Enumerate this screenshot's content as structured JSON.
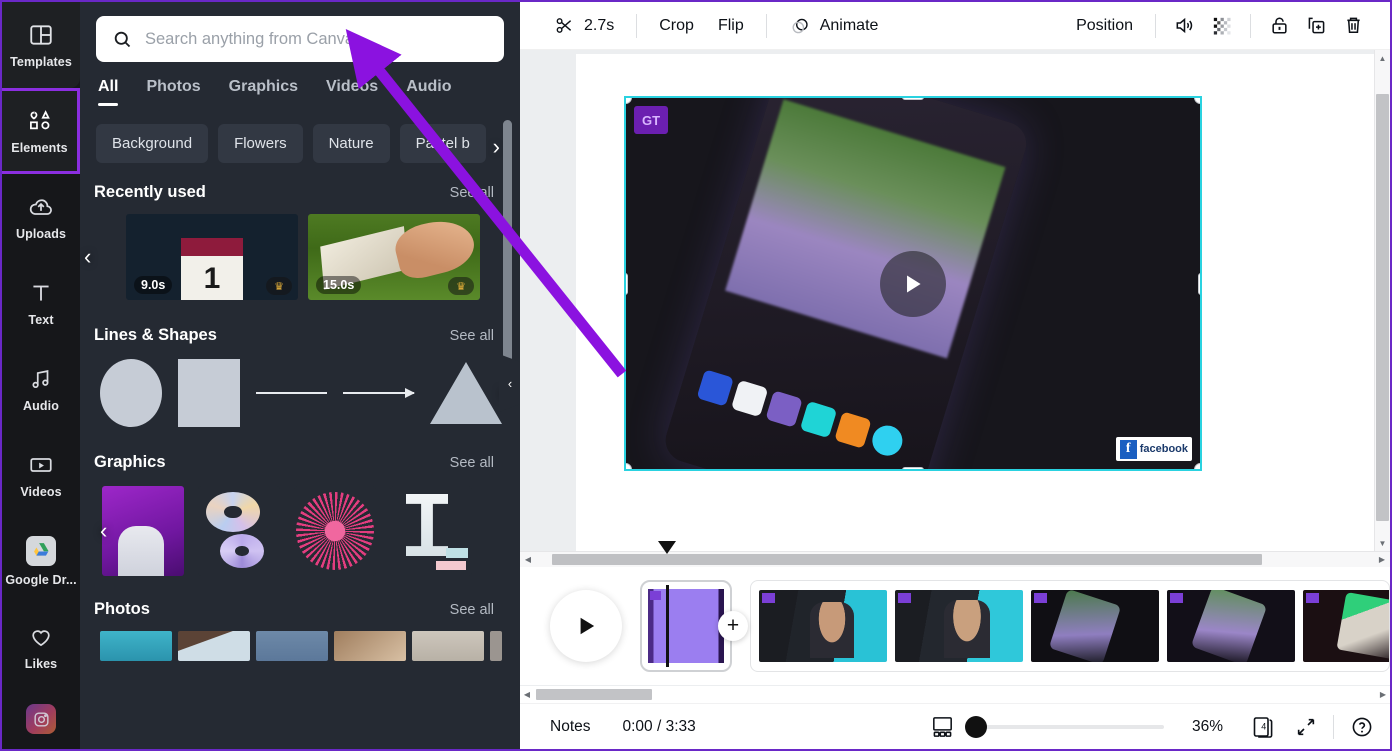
{
  "sidebar": {
    "items": [
      {
        "label": "Templates",
        "icon": "templates-icon"
      },
      {
        "label": "Elements",
        "icon": "elements-icon"
      },
      {
        "label": "Uploads",
        "icon": "uploads-icon"
      },
      {
        "label": "Text",
        "icon": "text-icon"
      },
      {
        "label": "Audio",
        "icon": "audio-icon"
      },
      {
        "label": "Videos",
        "icon": "videos-icon"
      },
      {
        "label": "Google Dr...",
        "icon": "google-drive-icon"
      },
      {
        "label": "Likes",
        "icon": "heart-icon"
      },
      {
        "label": "",
        "icon": "instagram-icon"
      }
    ],
    "active_index": 1,
    "active_outline_color": "#8b2ee0"
  },
  "search": {
    "placeholder": "Search anything from Canva",
    "value": "",
    "icon": "search-icon"
  },
  "tabs": [
    {
      "label": "All"
    },
    {
      "label": "Photos"
    },
    {
      "label": "Graphics"
    },
    {
      "label": "Videos"
    },
    {
      "label": "Audio"
    }
  ],
  "active_tab": "All",
  "chips": [
    {
      "label": "Background"
    },
    {
      "label": "Flowers"
    },
    {
      "label": "Nature"
    },
    {
      "label": "Pastel b"
    }
  ],
  "sections": [
    {
      "title": "Recently used",
      "see_all": "See all",
      "items": [
        {
          "duration": "9.0s",
          "premium": true
        },
        {
          "duration": "15.0s",
          "premium": true
        }
      ]
    },
    {
      "title": "Lines & Shapes",
      "see_all": "See all"
    },
    {
      "title": "Graphics",
      "see_all": "See all"
    },
    {
      "title": "Photos",
      "see_all": "See all"
    }
  ],
  "toolbar": {
    "trim_duration": "2.7s",
    "trim_icon": "scissors-icon",
    "crop_label": "Crop",
    "flip_label": "Flip",
    "animate_label": "Animate",
    "animate_icon": "animate-icon",
    "position_label": "Position",
    "volume_icon": "speaker-icon",
    "transparency_icon": "transparency-icon",
    "lock_icon": "lock-icon",
    "duplicate_icon": "duplicate-icon",
    "delete_icon": "trash-icon"
  },
  "canvas": {
    "element_badge": "GT",
    "watermark": "facebook",
    "watermark_letter": "f",
    "play_icon": "play-icon",
    "rotate_icon": "rotate-icon"
  },
  "timeline": {
    "play_icon": "play-icon",
    "add_label": "+",
    "clip_count": 5
  },
  "status": {
    "notes_label": "Notes",
    "time": "0:00 / 3:33",
    "zoom": "36%",
    "zoom_percent_value": 36,
    "page_count": "4",
    "layout_icon": "layout-icon",
    "pages-icon": "pages-icon",
    "expand_icon": "expand-icon",
    "help_icon": "help-icon"
  },
  "annotation": {
    "color": "#8b12e0",
    "type": "arrow",
    "points": "from (620,372) to (358,46)"
  }
}
